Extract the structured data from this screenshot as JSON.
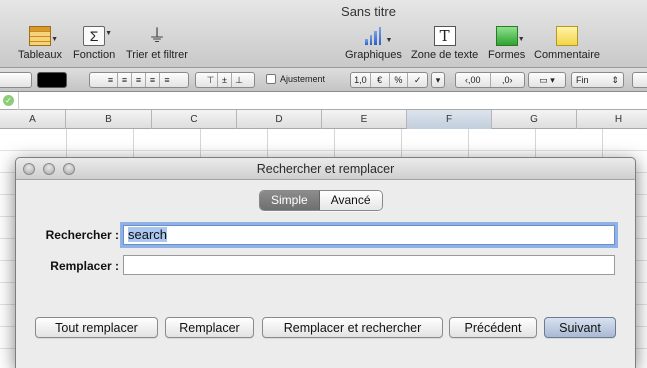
{
  "window": {
    "title": "Sans titre"
  },
  "toolbar": {
    "items": [
      {
        "label": "Tableaux",
        "icon": "table-icon",
        "has_menu": true
      },
      {
        "label": "Fonction",
        "icon": "sigma-icon",
        "has_menu": true
      },
      {
        "label": "Trier et filtrer",
        "icon": "filter-icon",
        "has_menu": false
      },
      {
        "label": "Graphiques",
        "icon": "chart-icon",
        "has_menu": true
      },
      {
        "label": "Zone de texte",
        "icon": "text-box-icon",
        "has_menu": false
      },
      {
        "label": "Formes",
        "icon": "shapes-icon",
        "has_menu": true
      },
      {
        "label": "Commentaire",
        "icon": "comment-icon",
        "has_menu": false
      }
    ]
  },
  "formatbar": {
    "wrap_label": "Ajustement",
    "number_buttons": [
      "1,0",
      "€",
      "%",
      "✓"
    ],
    "decimal_decrease": "‹,00",
    "decimal_increase": ",0›",
    "end_label": "Fin"
  },
  "columns": [
    "A",
    "B",
    "C",
    "D",
    "E",
    "F",
    "G",
    "H"
  ],
  "selected_column": "F",
  "dialog": {
    "title": "Rechercher et remplacer",
    "tabs": [
      {
        "label": "Simple",
        "active": true
      },
      {
        "label": "Avancé",
        "active": false
      }
    ],
    "find_label": "Rechercher :",
    "find_value": "search",
    "replace_label": "Remplacer :",
    "replace_value": "",
    "buttons": {
      "replace_all": "Tout remplacer",
      "replace": "Remplacer",
      "replace_and_find": "Remplacer et rechercher",
      "previous": "Précédent",
      "next": "Suivant"
    }
  },
  "colors": {
    "focus_ring": "#8fb2e6",
    "selection": "#a9c7ef",
    "default_button": "#a9b9d2"
  }
}
